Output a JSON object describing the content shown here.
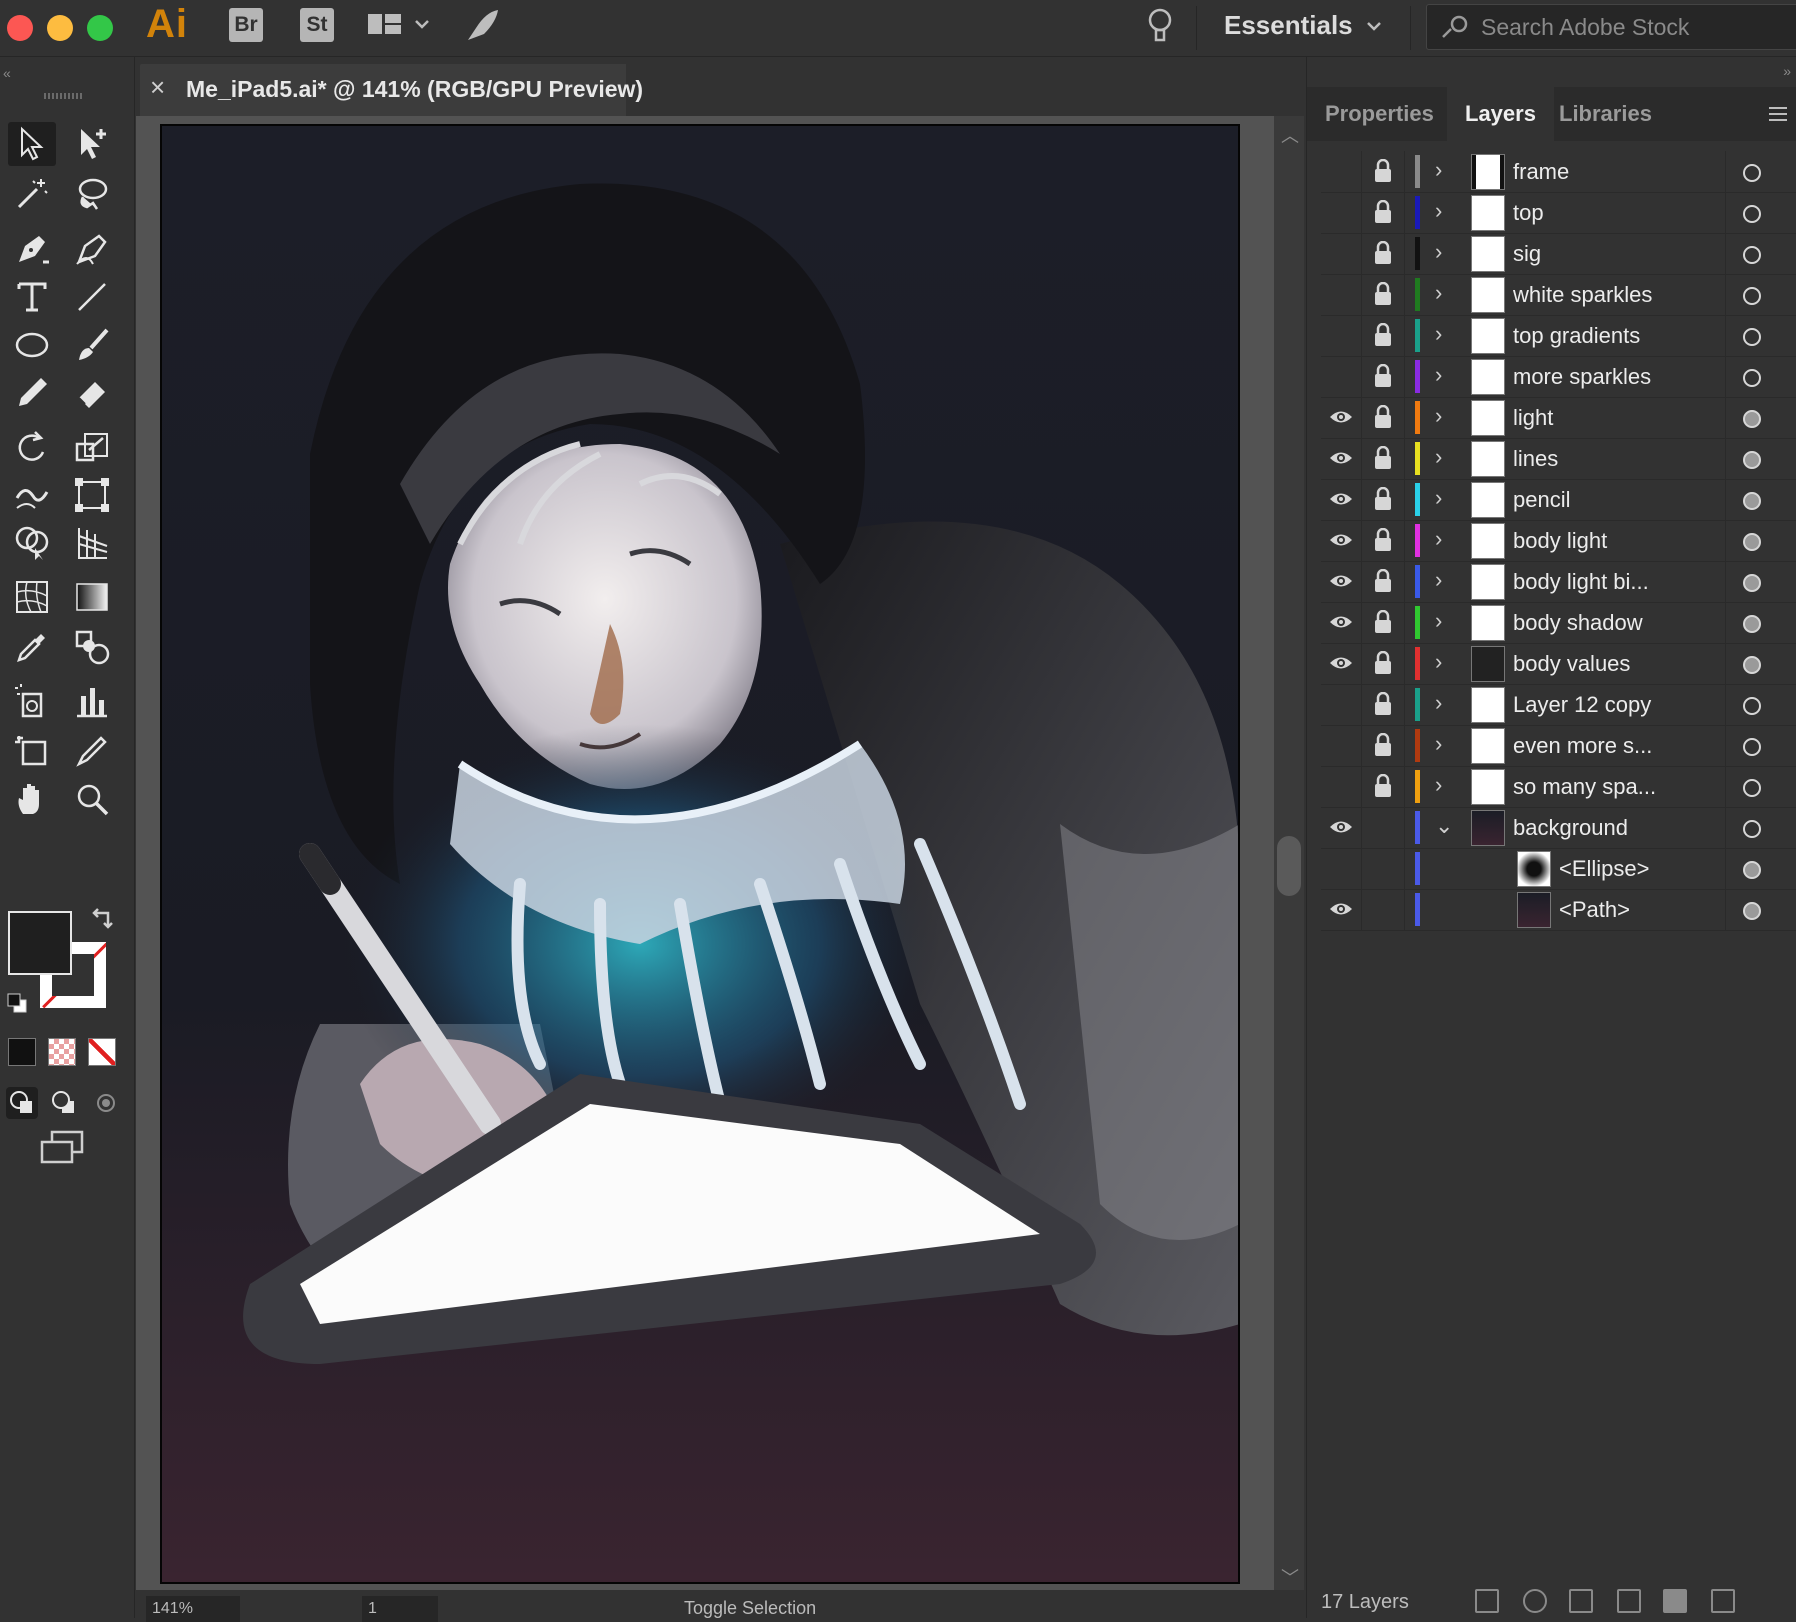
{
  "app": {
    "logo": "Ai",
    "bridge_badge": "Br",
    "stock_badge": "St",
    "workspace": "Essentials",
    "search_placeholder": "Search Adobe Stock"
  },
  "document": {
    "close_glyph": "×",
    "tab_title": "Me_iPad5.ai* @ 141% (RGB/GPU Preview)"
  },
  "statusbar": {
    "zoom": "141%",
    "artboard_index": "1",
    "label": "Toggle Selection"
  },
  "tools": [
    "selection-tool",
    "direct-selection-tool",
    "magic-wand-tool",
    "lasso-tool",
    "pen-tool",
    "curvature-tool",
    "type-tool",
    "line-segment-tool",
    "ellipse-tool",
    "paintbrush-tool",
    "pencil-tool",
    "eraser-tool",
    "rotate-tool",
    "scale-tool",
    "warp-tool",
    "free-transform-tool",
    "shape-builder-tool",
    "perspective-grid-tool",
    "mesh-tool",
    "gradient-tool",
    "eyedropper-tool",
    "blend-tool",
    "symbol-sprayer-tool",
    "column-graph-tool",
    "artboard-tool",
    "slice-tool",
    "hand-tool",
    "zoom-tool"
  ],
  "panel": {
    "tabs": [
      "Properties",
      "Layers",
      "Libraries"
    ],
    "active_tab": "Layers",
    "layer_count_label": "17 Layers"
  },
  "layers": [
    {
      "name": "frame",
      "color": "#8a8a8a",
      "visible": false,
      "locked": true,
      "expanded": false,
      "level": 0
    },
    {
      "name": "top",
      "color": "#1a1ab8",
      "visible": false,
      "locked": true,
      "expanded": false,
      "level": 0
    },
    {
      "name": "sig",
      "color": "#111111",
      "visible": false,
      "locked": true,
      "expanded": false,
      "level": 0
    },
    {
      "name": "white sparkles",
      "color": "#1f7a1f",
      "visible": false,
      "locked": true,
      "expanded": false,
      "level": 0
    },
    {
      "name": "top gradients",
      "color": "#1aa08a",
      "visible": false,
      "locked": true,
      "expanded": false,
      "level": 0
    },
    {
      "name": "more sparkles",
      "color": "#8a2be2",
      "visible": false,
      "locked": true,
      "expanded": false,
      "level": 0
    },
    {
      "name": "light",
      "color": "#f07a10",
      "visible": true,
      "locked": true,
      "expanded": false,
      "level": 0
    },
    {
      "name": "lines",
      "color": "#e8e020",
      "visible": true,
      "locked": true,
      "expanded": false,
      "level": 0
    },
    {
      "name": "pencil",
      "color": "#2ad0e8",
      "visible": true,
      "locked": true,
      "expanded": false,
      "level": 0
    },
    {
      "name": "body light",
      "color": "#e030e0",
      "visible": true,
      "locked": true,
      "expanded": false,
      "level": 0
    },
    {
      "name": "body light bi...",
      "color": "#3a5ae8",
      "visible": true,
      "locked": true,
      "expanded": false,
      "level": 0
    },
    {
      "name": "body shadow",
      "color": "#30c830",
      "visible": true,
      "locked": true,
      "expanded": false,
      "level": 0
    },
    {
      "name": "body values",
      "color": "#e03030",
      "visible": true,
      "locked": true,
      "expanded": false,
      "level": 0
    },
    {
      "name": "Layer 12 copy",
      "color": "#1aa08a",
      "visible": false,
      "locked": true,
      "expanded": false,
      "level": 0
    },
    {
      "name": "even more s...",
      "color": "#b03a10",
      "visible": false,
      "locked": true,
      "expanded": false,
      "level": 0
    },
    {
      "name": "so many spa...",
      "color": "#f0a010",
      "visible": false,
      "locked": true,
      "expanded": false,
      "level": 0
    },
    {
      "name": "background",
      "color": "#4a5ae8",
      "visible": true,
      "locked": false,
      "expanded": true,
      "level": 0
    },
    {
      "name": "<Ellipse>",
      "color": "#4a5ae8",
      "visible": false,
      "locked": false,
      "expanded": false,
      "level": 1
    },
    {
      "name": "<Path>",
      "color": "#4a5ae8",
      "visible": true,
      "locked": false,
      "expanded": false,
      "level": 1
    }
  ],
  "colors": {
    "fill": "#1f1f1f",
    "stroke": "none",
    "accent_traffic_red": "#fc5753",
    "accent_traffic_yellow": "#fdbc40",
    "accent_traffic_green": "#33c748"
  }
}
